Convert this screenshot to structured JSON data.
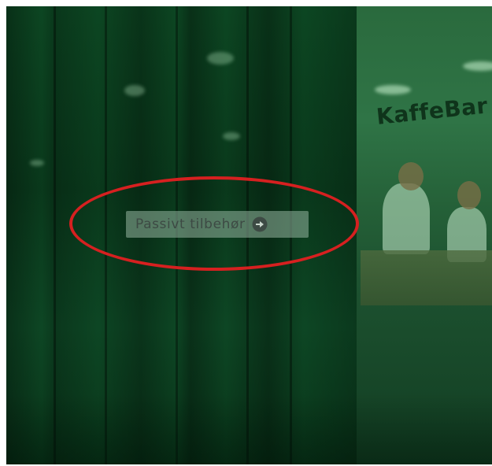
{
  "banner": {
    "sign_text": "KaffeBar",
    "cta": {
      "label": "Passivt tilbehør",
      "icon": "arrow-right-circle-icon"
    }
  },
  "annotation": {
    "shape": "ellipse",
    "color": "#d62020",
    "target": "cta-button"
  },
  "colors": {
    "overlay_green": "#0b3a1d",
    "button_bg": "#96b4a0",
    "button_text": "#3d4a44"
  }
}
